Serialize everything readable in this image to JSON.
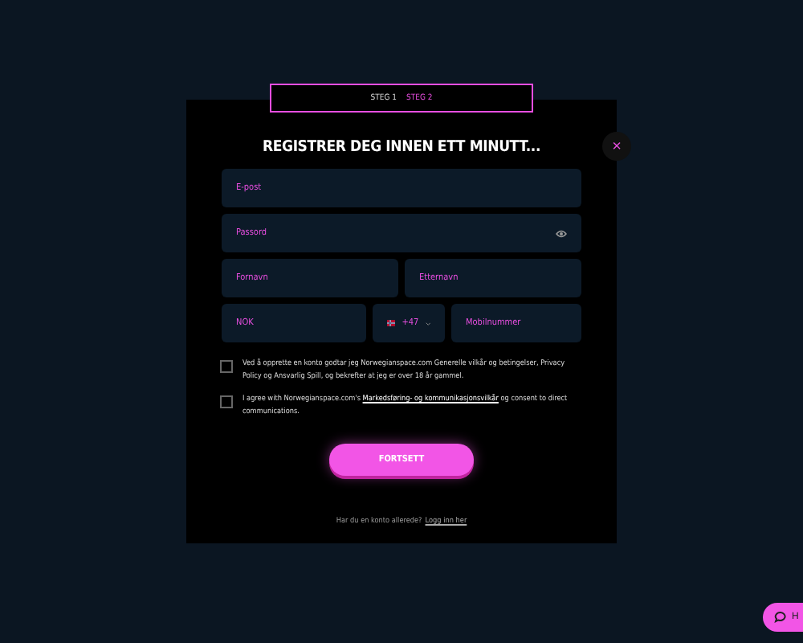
{
  "steps": [
    {
      "label": "STEG 1",
      "selected": false
    },
    {
      "label": "STEG 2",
      "selected": true
    }
  ],
  "title": "REGISTRER DEG INNEN ETT MINUTT...",
  "close": "×",
  "fields": {
    "email": {
      "placeholder": "E-post"
    },
    "password": {
      "placeholder": "Passord"
    },
    "first_name": {
      "placeholder": "Fornavn"
    },
    "last_name": {
      "placeholder": "Etternavn"
    },
    "currency": {
      "value": "NOK"
    },
    "country_code": {
      "value": "+47"
    },
    "phone": {
      "placeholder": "Mobilnummer"
    }
  },
  "consents": [
    {
      "checked": false,
      "text": "Ved å opprette en konto godtar jeg Norwegianspace.com Generelle vilkår og betingelser, Privacy Policy og Ansvarlig Spill, og bekrefter at jeg er over 18 år gammel."
    },
    {
      "checked": false,
      "text": "I agree with Norwegianspace.com's",
      "link": "Markedsføring- og kommunikasjonsvilkår",
      "after": "og consent to direct communications."
    }
  ],
  "submit": "FORTSETT",
  "footer": {
    "text": "Har du en konto allerede?",
    "link": "Logg inn her"
  },
  "chat": {
    "label": "H"
  }
}
